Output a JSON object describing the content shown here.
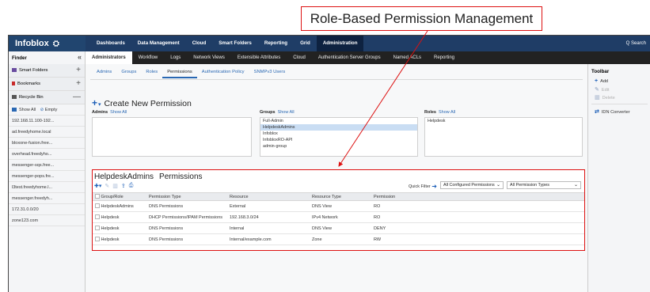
{
  "callout": "Role-Based Permission Management",
  "brand": {
    "name": "Infoblox",
    "mark": "⛭"
  },
  "topnav": [
    "Dashboards",
    "Data Management",
    "Cloud",
    "Smart Folders",
    "Reporting",
    "Grid",
    "Administration"
  ],
  "search": "Q Search",
  "subnav": [
    "Administrators",
    "Workflow",
    "Logs",
    "Network Views",
    "Extensible Attributes",
    "Cloud",
    "Authentication Server Groups",
    "Named ACLs",
    "Reporting"
  ],
  "finder": {
    "title": "Finder",
    "collapse": "«",
    "sections": [
      {
        "label": "Smart Folders",
        "action": "+"
      },
      {
        "label": "Bookmarks",
        "action": "+"
      },
      {
        "label": "Recycle Bin",
        "action": "—"
      }
    ],
    "show_all": "Show All",
    "empty": "Empty",
    "items": [
      "192.168.11.100-192...",
      "ad.freedyhome.local",
      "bloxone-fusion.free...",
      "overhead.freedyho...",
      "messenger-sqs.free...",
      "messenger-pops.fre...",
      "l3test.freedyhome.l...",
      "messenger.freedyh...",
      "172.31.0.0/20",
      "zone123.com"
    ]
  },
  "tabs": [
    "Admins",
    "Groups",
    "Roles",
    "Permissions",
    "Authentication Policy",
    "SNMPv3 Users"
  ],
  "create": {
    "title": "Create New Permission"
  },
  "columns": {
    "admins": {
      "label": "Admins",
      "link": "Show All",
      "items": []
    },
    "groups": {
      "label": "Groups",
      "link": "Show All",
      "items": [
        "Full-Admin",
        "HelpdeskAdmins",
        "Infoblox",
        "InfobloxRO-API",
        "admin-group"
      ],
      "selected": 1
    },
    "roles": {
      "label": "Roles",
      "link": "Show All",
      "items": [
        "Helpdesk"
      ]
    }
  },
  "permissions": {
    "group": "HelpdeskAdmins",
    "title": "Permissions",
    "quick_filter": "Quick Filter",
    "filter1": "All Configured Permissions",
    "filter2": "All Permission Types",
    "headers": [
      "Group/Role",
      "Permission Type",
      "Resource",
      "Resource Type",
      "Permission"
    ],
    "rows": [
      [
        "HelpdeskAdmins",
        "DNS Permissions",
        "External",
        "DNS View",
        "RO"
      ],
      [
        "Helpdesk",
        "DHCP Permissions/IPAM Permissions",
        "192.168.3.0/24",
        "IPv4 Network",
        "RO"
      ],
      [
        "Helpdesk",
        "DNS Permissions",
        "Internal",
        "DNS View",
        "DENY"
      ],
      [
        "Helpdesk",
        "DNS Permissions",
        "Internal/example.com",
        "Zone",
        "RW"
      ]
    ]
  },
  "toolbar": {
    "title": "Toolbar",
    "items": [
      {
        "label": "Add",
        "icon": "+",
        "enabled": true
      },
      {
        "label": "Edit",
        "icon": "✎",
        "enabled": false
      },
      {
        "label": "Delete",
        "icon": "🗑",
        "enabled": false
      },
      {
        "label": "IDN Converter",
        "icon": "⇄",
        "enabled": true
      }
    ]
  },
  "colors": {
    "topbar": "#1f3d66",
    "accent": "#1c5fb8",
    "highlight": "#dd1111"
  }
}
